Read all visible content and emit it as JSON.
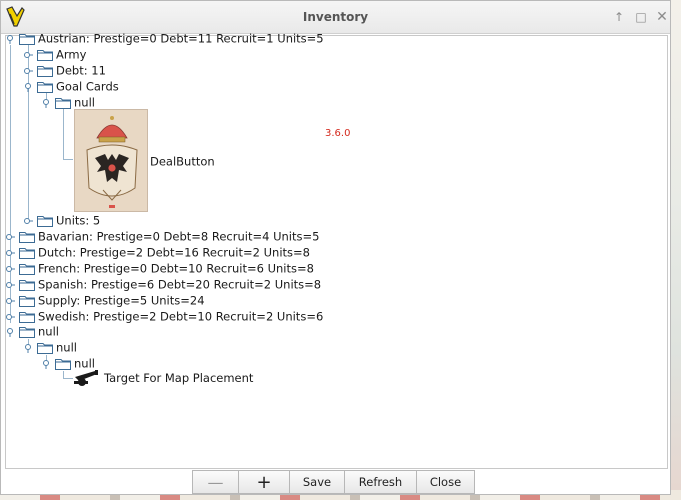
{
  "window": {
    "title": "Inventory"
  },
  "tree": {
    "austrian": "Austrian: Prestige=0 Debt=11 Recruit=1 Units=5",
    "army": "Army",
    "debt": "Debt: 11",
    "goal_cards": "Goal Cards",
    "null_1": "null",
    "deal_button": "DealButton",
    "units": "Units: 5",
    "bavarian": "Bavarian: Prestige=0 Debt=8 Recruit=4 Units=5",
    "dutch": "Dutch: Prestige=2 Debt=16 Recruit=2 Units=8",
    "french": "French: Prestige=0 Debt=10 Recruit=6 Units=8",
    "spanish": "Spanish: Prestige=6 Debt=20 Recruit=2 Units=8",
    "supply": "Supply: Prestige=5 Units=24",
    "swedish": "Swedish: Prestige=2 Debt=10 Recruit=2 Units=6",
    "null_2": "null",
    "null_3": "null",
    "null_4": "null",
    "target": "Target For Map Placement"
  },
  "version": "3.6.0",
  "buttons": {
    "minus": "—",
    "plus": "+",
    "save": "Save",
    "refresh": "Refresh",
    "close": "Close"
  },
  "icons": {
    "window": "app-icon",
    "node_expanded": "expanded-knob-icon",
    "node_collapsed": "collapsed-knob-icon",
    "folder": "folder-icon",
    "card": "goal-card-image",
    "cannon": "cannon-icon"
  },
  "colors": {
    "version_text": "#d42a1e",
    "tree_line": "#9bb6cc"
  }
}
